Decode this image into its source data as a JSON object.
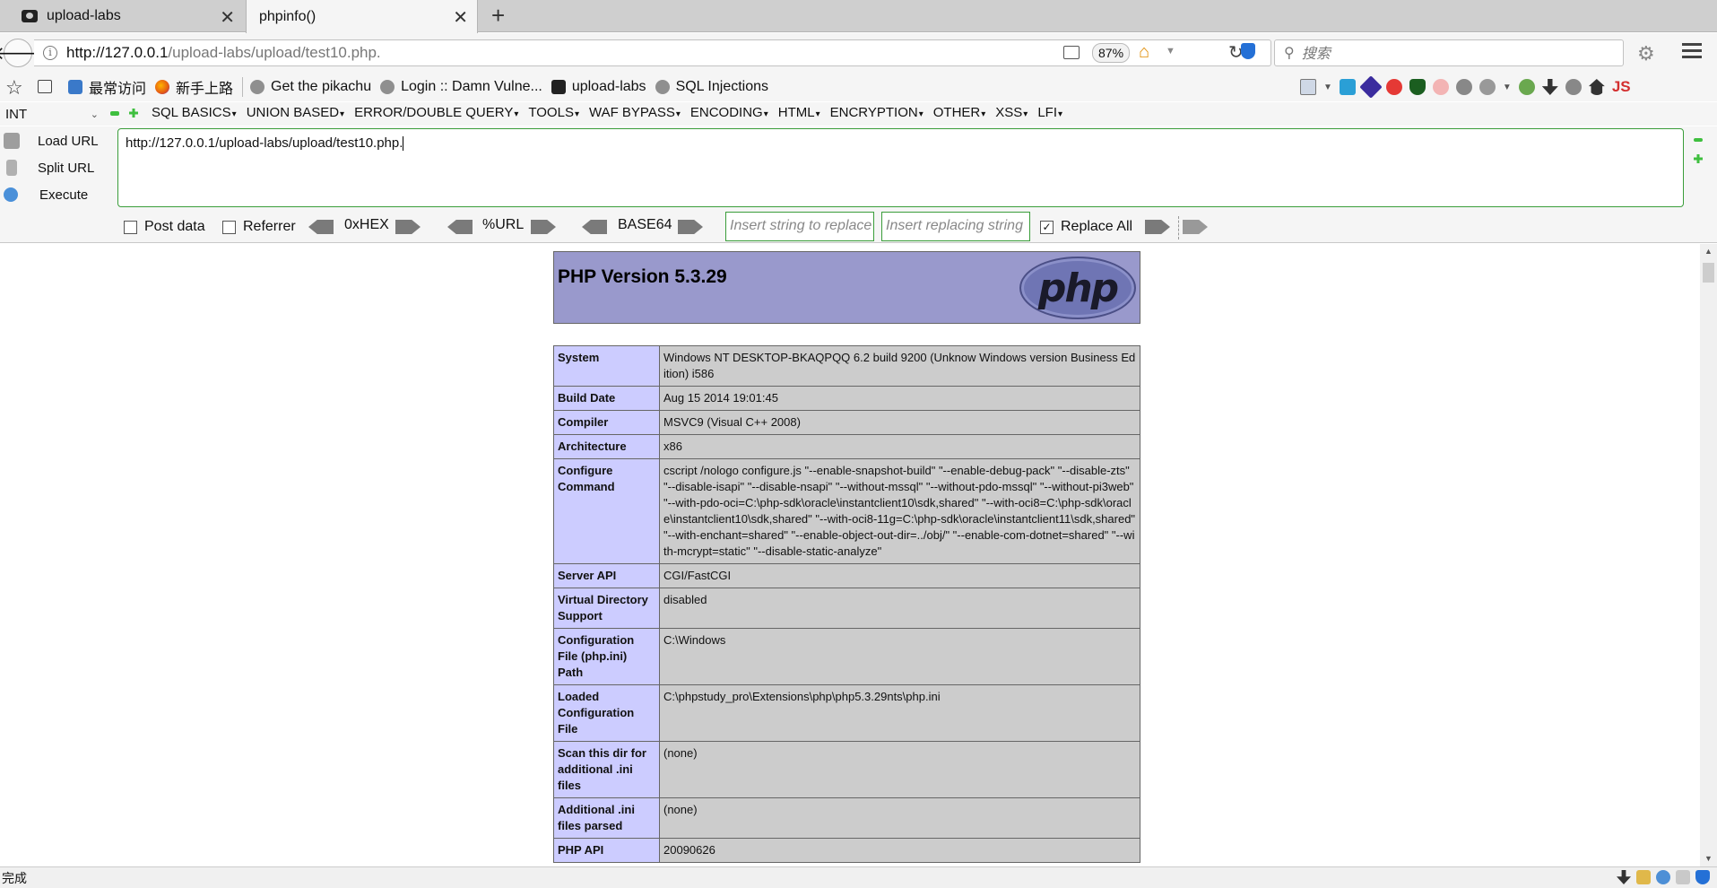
{
  "tabs": [
    {
      "title": "upload-labs",
      "active": false
    },
    {
      "title": "phpinfo()",
      "active": true
    }
  ],
  "nav": {
    "url_host": "http://127.0.0.1",
    "url_path": "/upload-labs/upload/test10.php.",
    "zoom": "87%",
    "search_placeholder": "搜索"
  },
  "bookmarks": [
    {
      "label": "最常访问",
      "icon": "frequent-icon"
    },
    {
      "label": "新手上路",
      "icon": "firefox-icon"
    },
    {
      "label": "Get the pikachu",
      "icon": "globe-icon"
    },
    {
      "label": "Login :: Damn Vulne...",
      "icon": "globe-icon"
    },
    {
      "label": "upload-labs",
      "icon": "site-icon"
    },
    {
      "label": "SQL Injections",
      "icon": "globe-icon"
    }
  ],
  "hackbar": {
    "mode": "INT",
    "menus": [
      "SQL BASICS",
      "UNION BASED",
      "ERROR/DOUBLE QUERY",
      "TOOLS",
      "WAF BYPASS",
      "ENCODING",
      "HTML",
      "ENCRYPTION",
      "OTHER",
      "XSS",
      "LFI"
    ],
    "load_url": "Load URL",
    "split_url": "Split URL",
    "execute": "Execute",
    "url_value": "http://127.0.0.1/upload-labs/upload/test10.php.",
    "post_data": "Post data",
    "referrer": "Referrer",
    "hex": "0xHEX",
    "urlenc": "%URL",
    "base64": "BASE64",
    "replace_from_placeholder": "Insert string to replace",
    "replace_to_placeholder": "Insert replacing string",
    "replace_all": "Replace All",
    "replace_all_checked": true
  },
  "php": {
    "version_title": "PHP Version 5.3.29",
    "logo_text": "php",
    "rows": [
      {
        "key": "System",
        "value": "Windows NT DESKTOP-BKAQPQQ 6.2 build 9200 (Unknow Windows version Business Edition) i586"
      },
      {
        "key": "Build Date",
        "value": "Aug 15 2014 19:01:45"
      },
      {
        "key": "Compiler",
        "value": "MSVC9 (Visual C++ 2008)"
      },
      {
        "key": "Architecture",
        "value": "x86"
      },
      {
        "key": "Configure Command",
        "value": "cscript /nologo configure.js \"--enable-snapshot-build\" \"--enable-debug-pack\" \"--disable-zts\" \"--disable-isapi\" \"--disable-nsapi\" \"--without-mssql\" \"--without-pdo-mssql\" \"--without-pi3web\" \"--with-pdo-oci=C:\\php-sdk\\oracle\\instantclient10\\sdk,shared\" \"--with-oci8=C:\\php-sdk\\oracle\\instantclient10\\sdk,shared\" \"--with-oci8-11g=C:\\php-sdk\\oracle\\instantclient11\\sdk,shared\" \"--with-enchant=shared\" \"--enable-object-out-dir=../obj/\" \"--enable-com-dotnet=shared\" \"--with-mcrypt=static\" \"--disable-static-analyze\""
      },
      {
        "key": "Server API",
        "value": "CGI/FastCGI"
      },
      {
        "key": "Virtual Directory Support",
        "value": "disabled"
      },
      {
        "key": "Configuration File (php.ini) Path",
        "value": "C:\\Windows"
      },
      {
        "key": "Loaded Configuration File",
        "value": "C:\\phpstudy_pro\\Extensions\\php\\php5.3.29nts\\php.ini"
      },
      {
        "key": "Scan this dir for additional .ini files",
        "value": "(none)"
      },
      {
        "key": "Additional .ini files parsed",
        "value": "(none)"
      },
      {
        "key": "PHP API",
        "value": "20090626"
      }
    ]
  },
  "status": "完成"
}
